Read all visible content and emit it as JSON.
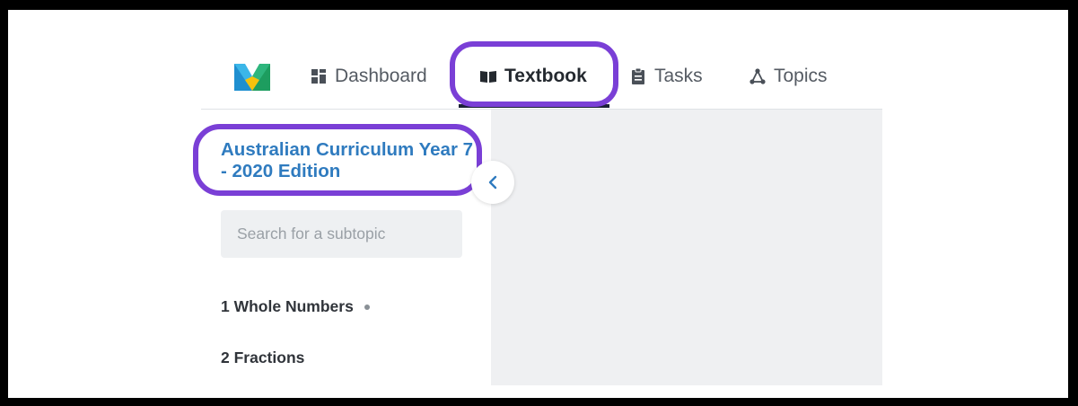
{
  "nav": {
    "logo": "mathspace-logo",
    "items": [
      {
        "label": "Dashboard",
        "icon": "dashboard-icon"
      },
      {
        "label": "Textbook",
        "icon": "book-icon",
        "active": true
      },
      {
        "label": "Tasks",
        "icon": "clipboard-icon"
      },
      {
        "label": "Topics",
        "icon": "topics-icon"
      }
    ]
  },
  "sidebar": {
    "title": "Australian Curriculum Year 7 - 2020 Edition",
    "search_placeholder": "Search for a subtopic",
    "topics": [
      {
        "label": "1 Whole Numbers"
      },
      {
        "label": "2 Fractions"
      }
    ],
    "collapse_icon": "chevron-left-icon"
  },
  "colors": {
    "highlight": "#7a3fd6",
    "title_blue": "#2f7bbf",
    "content_bg": "#eff0f2"
  }
}
